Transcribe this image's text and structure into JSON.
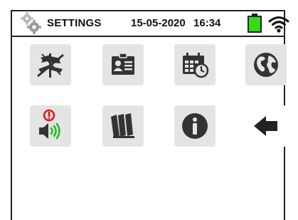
{
  "header": {
    "title": "SETTINGS",
    "date": "15-05-2020",
    "time": "16:34"
  },
  "colors": {
    "battery_fill": "#33dd11",
    "icon_dark": "#333333",
    "tile_bg": "#e4e4e4",
    "alert_red": "#ee1111",
    "sound_green": "#22bb22"
  },
  "menu": {
    "items": [
      {
        "icon": "language-flags-icon"
      },
      {
        "icon": "operator-id-card-icon"
      },
      {
        "icon": "date-time-calendar-icon"
      },
      {
        "icon": "globe-region-icon"
      },
      {
        "icon": "sound-alarm-icon"
      },
      {
        "icon": "library-books-icon"
      },
      {
        "icon": "info-icon"
      },
      {
        "icon": "back-arrow-icon"
      }
    ]
  }
}
